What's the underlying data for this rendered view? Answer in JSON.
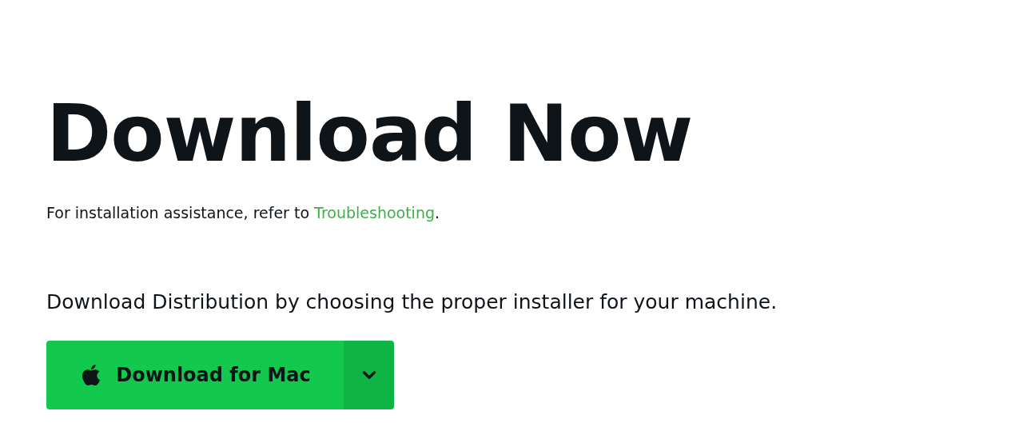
{
  "heading": "Download Now",
  "note": {
    "before": "For installation assistance, refer to ",
    "link": "Troubleshooting",
    "after": "."
  },
  "intro": "Download Distribution by choosing the proper installer for your machine.",
  "download_button": {
    "label": "Download for Mac"
  }
}
